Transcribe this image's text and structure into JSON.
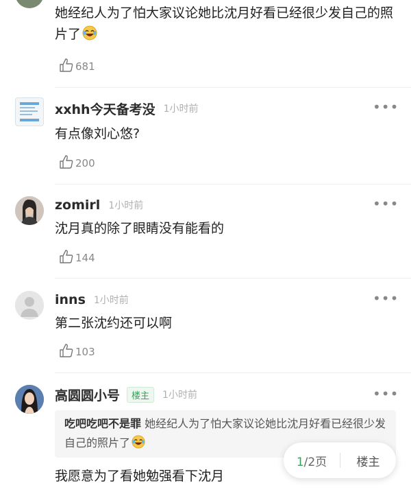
{
  "comments": [
    {
      "username": "",
      "time": "",
      "text": "她经纪人为了怕大家议论她比沈月好看已经很少发自己的照片了",
      "likes": "681",
      "emoji_icon": "laughing-tears-emoji"
    },
    {
      "username": "xxhh今天备考没",
      "time": "1小时前",
      "text": "有点像刘心悠?",
      "likes": "200"
    },
    {
      "username": "zomirl",
      "time": "1小时前",
      "text": "沈月真的除了眼睛没有能看的",
      "likes": "144"
    },
    {
      "username": "inns",
      "time": "1小时前",
      "text": "第二张沈约还可以啊",
      "likes": "103"
    },
    {
      "username": "高圆圆小号",
      "badge": "楼主",
      "time": "1小时前",
      "quote_author": "吃吧吃吧不是罪",
      "quote_text": "她经纪人为了怕大家议论她比沈月好看已经很少发自己的照片了",
      "text": "我愿意为了看她勉强看下沈月"
    }
  ],
  "more_label": "•••",
  "pager": {
    "current": "1",
    "total_label": "/2页",
    "op_label": "楼主"
  },
  "colors": {
    "accent_green": "#3aa05a",
    "muted_text": "#888888",
    "time_text": "#b0b0b0"
  }
}
